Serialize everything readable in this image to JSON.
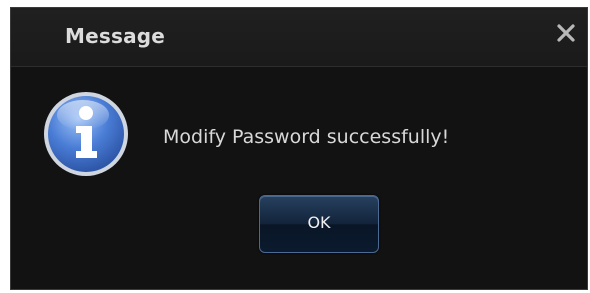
{
  "dialog": {
    "title": "Message",
    "close_icon": "close-icon",
    "info_icon": "info-icon",
    "message": "Modify Password successfully!",
    "ok_label": "OK"
  },
  "colors": {
    "dialog_background": "#121212",
    "title_text": "#dcdcdc",
    "message_text": "#d8d8d8",
    "button_background": "#12233a",
    "icon_blue": "#3f6fc4"
  }
}
